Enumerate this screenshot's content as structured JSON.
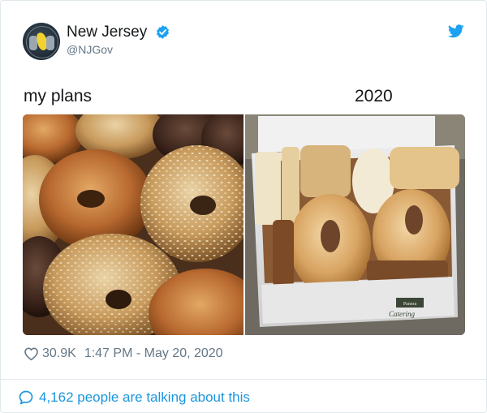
{
  "tweet": {
    "author_name": "New Jersey",
    "author_handle": "@NJGov",
    "verified_icon": "verified-badge-icon",
    "brand_icon": "twitter-bird-icon",
    "captions": {
      "left": "my plans",
      "right": "2020"
    },
    "images": {
      "left": {
        "subject": "gourmet-bagels"
      },
      "right": {
        "subject": "catering-box-bagels",
        "box_print": [
          "Panera",
          "Catering"
        ]
      }
    },
    "likes": "30.9K",
    "timestamp": "1:47 PM - May 20, 2020",
    "talking": "4,162 people are talking about this"
  },
  "colors": {
    "accent": "#1da1f2",
    "link": "#1b95e0",
    "meta_text": "#657786",
    "text": "#14171a",
    "border": "#e1e8ed"
  }
}
